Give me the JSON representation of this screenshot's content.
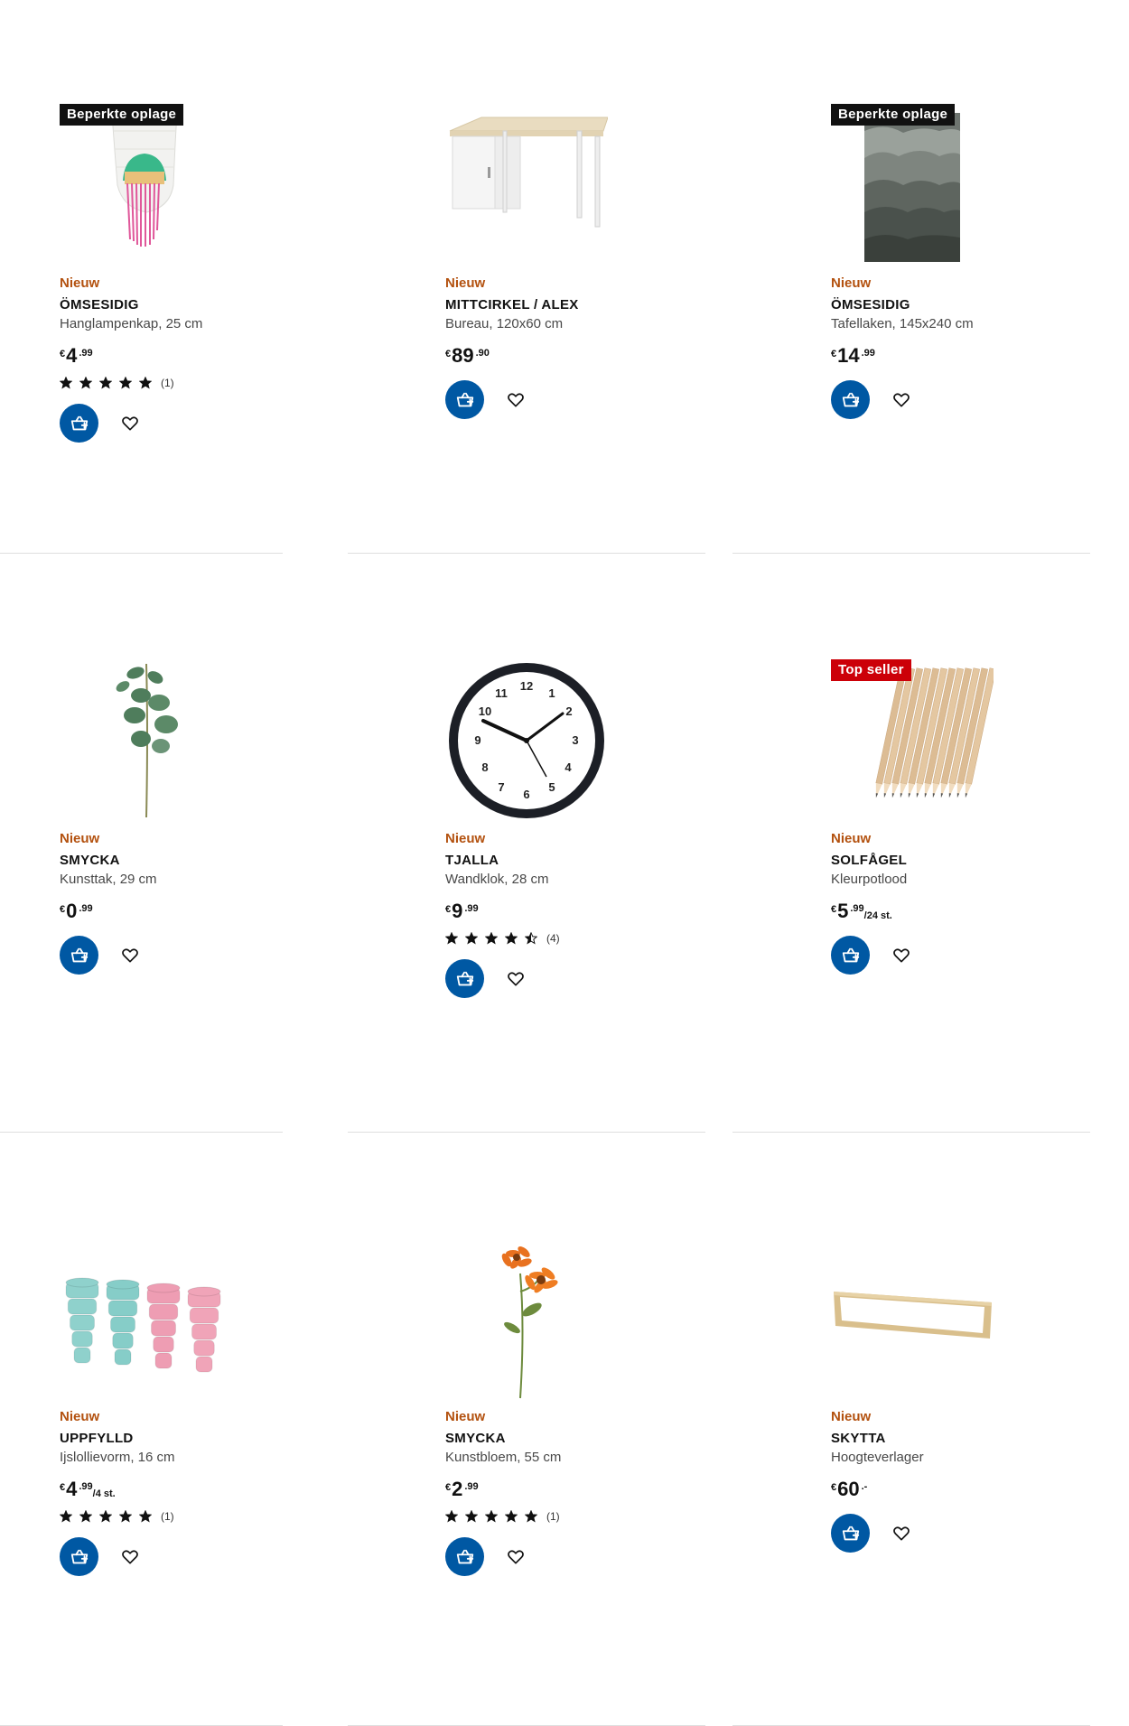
{
  "colors": {
    "new_label": "#b3510f",
    "cart_button": "#0058a3",
    "badge_dark": "#111111",
    "badge_red": "#cc0008"
  },
  "products": [
    {
      "badge": "Beperkte oplage",
      "badge_style": "dark",
      "image": "paper-lamp-shade",
      "new_label": "Nieuw",
      "name": "ÖMSESIDIG",
      "description": "Hanglampenkap, 25 cm",
      "price": {
        "currency": "€",
        "integer": "4",
        "decimal": ".99",
        "unit": ""
      },
      "rating": {
        "stars": 5,
        "count": "(1)"
      }
    },
    {
      "badge": "",
      "badge_style": "",
      "image": "desk",
      "new_label": "Nieuw",
      "name": "MITTCIRKEL / ALEX",
      "description": "Bureau, 120x60 cm",
      "price": {
        "currency": "€",
        "integer": "89",
        "decimal": ".90",
        "unit": ""
      },
      "rating": null
    },
    {
      "badge": "Beperkte oplage",
      "badge_style": "dark",
      "image": "tablecloth",
      "new_label": "Nieuw",
      "name": "ÖMSESIDIG",
      "description": "Tafellaken, 145x240 cm",
      "price": {
        "currency": "€",
        "integer": "14",
        "decimal": ".99",
        "unit": ""
      },
      "rating": null
    },
    {
      "badge": "",
      "badge_style": "",
      "image": "eucalyptus-stem",
      "new_label": "Nieuw",
      "name": "SMYCKA",
      "description": "Kunsttak, 29 cm",
      "price": {
        "currency": "€",
        "integer": "0",
        "decimal": ".99",
        "unit": ""
      },
      "rating": null
    },
    {
      "badge": "",
      "badge_style": "",
      "image": "wall-clock",
      "new_label": "Nieuw",
      "name": "TJALLA",
      "description": "Wandklok, 28 cm",
      "price": {
        "currency": "€",
        "integer": "9",
        "decimal": ".99",
        "unit": ""
      },
      "rating": {
        "stars": 4.5,
        "count": "(4)"
      }
    },
    {
      "badge": "Top seller",
      "badge_style": "red",
      "image": "colour-pencils",
      "new_label": "Nieuw",
      "name": "SOLFÅGEL",
      "description": "Kleurpotlood",
      "price": {
        "currency": "€",
        "integer": "5",
        "decimal": ".99",
        "unit": "/24 st."
      },
      "rating": null
    },
    {
      "badge": "",
      "badge_style": "",
      "image": "ice-lolly-moulds",
      "new_label": "Nieuw",
      "name": "UPPFYLLD",
      "description": "Ijslollievorm, 16 cm",
      "price": {
        "currency": "€",
        "integer": "4",
        "decimal": ".99",
        "unit": "/4 st."
      },
      "rating": {
        "stars": 5,
        "count": "(1)"
      }
    },
    {
      "badge": "",
      "badge_style": "",
      "image": "artificial-flower",
      "new_label": "Nieuw",
      "name": "SMYCKA",
      "description": "Kunstbloem, 55 cm",
      "price": {
        "currency": "€",
        "integer": "2",
        "decimal": ".99",
        "unit": ""
      },
      "rating": {
        "stars": 5,
        "count": "(1)"
      }
    },
    {
      "badge": "",
      "badge_style": "",
      "image": "height-extension-frame",
      "new_label": "Nieuw",
      "name": "SKYTTA",
      "description": "Hoogteverlager",
      "price": {
        "currency": "€",
        "integer": "60",
        "decimal": ".-",
        "unit": ""
      },
      "rating": null
    }
  ]
}
